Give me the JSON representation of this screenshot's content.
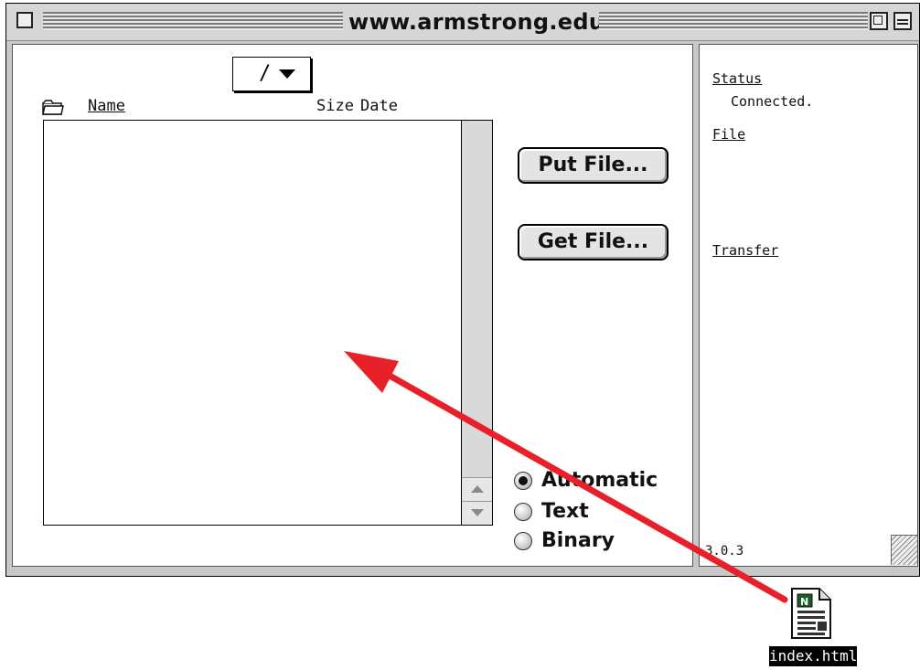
{
  "window": {
    "title": "www.armstrong.edu"
  },
  "remote_pane": {
    "path": "/",
    "columns": {
      "name": "Name",
      "size": "Size",
      "date": "Date"
    },
    "files": []
  },
  "buttons": {
    "put_file": "Put File...",
    "get_file": "Get File..."
  },
  "transfer_mode": {
    "options": [
      "Automatic",
      "Text",
      "Binary"
    ],
    "selected": "Automatic"
  },
  "info_panel": {
    "status_label": "Status",
    "status_value": "Connected.",
    "file_label": "File",
    "transfer_label": "Transfer",
    "version": "3.0.3"
  },
  "desktop": {
    "file_icon_name": "netscape-document-icon",
    "file_name": "index.html"
  },
  "annotation": {
    "arrow_color": "#e8202a"
  }
}
